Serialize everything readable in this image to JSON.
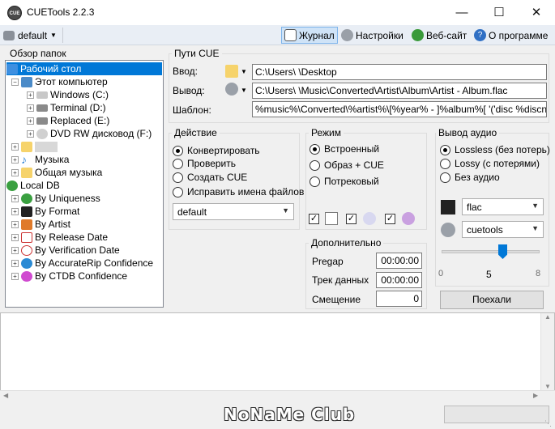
{
  "window": {
    "title": "CUETools 2.2.3",
    "icon_text": "CUE"
  },
  "toolbar": {
    "profile": "default",
    "journal": "Журнал",
    "settings": "Настройки",
    "website": "Веб-сайт",
    "about": "О программе"
  },
  "folder_tree": {
    "label": "Обзор папок",
    "items": [
      {
        "label": "Рабочий стол"
      },
      {
        "label": "Этот компьютер"
      },
      {
        "label": "Windows (C:)"
      },
      {
        "label": "Terminal (D:)"
      },
      {
        "label": "Replaced (E:)"
      },
      {
        "label": "DVD RW дисковод (F:)"
      },
      {
        "label": ""
      },
      {
        "label": "Музыка"
      },
      {
        "label": "Общая музыка"
      },
      {
        "label": "Local DB"
      },
      {
        "label": "By Uniqueness"
      },
      {
        "label": "By Format"
      },
      {
        "label": "By Artist"
      },
      {
        "label": "By Release Date"
      },
      {
        "label": "By Verification Date"
      },
      {
        "label": "By AccurateRip Confidence"
      },
      {
        "label": "By CTDB Confidence"
      }
    ]
  },
  "paths": {
    "group_title": "Пути CUE",
    "input_label": "Ввод:",
    "input_value": "C:\\Users\\        \\Desktop",
    "output_label": "Вывод:",
    "output_value": "C:\\Users\\        \\Music\\Converted\\Artist\\Album\\Artist - Album.flac",
    "template_label": "Шаблон:",
    "template_value": "%music%\\Converted\\%artist%\\[%year% - ]%album%[ '('disc %discn"
  },
  "action": {
    "group_title": "Действие",
    "options": [
      "Конвертировать",
      "Проверить",
      "Создать CUE",
      "Исправить имена файлов"
    ],
    "selected": 0,
    "profile_combo": "default"
  },
  "mode": {
    "group_title": "Режим",
    "options": [
      "Встроенный",
      "Образ + CUE",
      "Потрековый"
    ],
    "selected": 0
  },
  "extra": {
    "group_title": "Дополнительно",
    "pregap_label": "Pregap",
    "pregap_value": "00:00:00",
    "data_track_label": "Трек данных",
    "data_track_value": "00:00:00",
    "offset_label": "Смещение",
    "offset_value": "0"
  },
  "audio": {
    "group_title": "Вывод аудио",
    "options": [
      "Lossless (без потерь)",
      "Lossy (с потерями)",
      "Без аудио"
    ],
    "selected": 0,
    "format": "flac",
    "encoder": "cuetools",
    "slider_min": "0",
    "slider_value": "5",
    "slider_max": "8",
    "go_button": "Поехали"
  },
  "watermark": "NoNaMe Club"
}
